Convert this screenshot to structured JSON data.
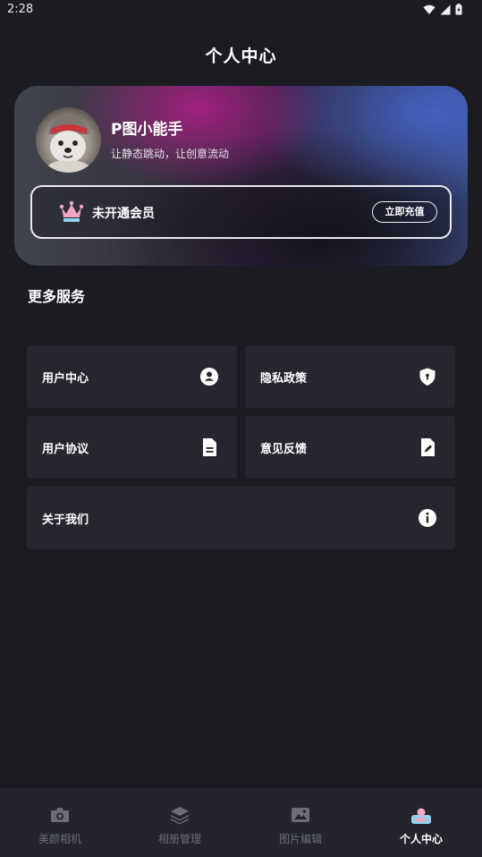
{
  "status_bar": {
    "time": "2:28"
  },
  "header": {
    "title": "个人中心"
  },
  "profile": {
    "name": "P图小能手",
    "slogan": "让静态跳动，让创意流动"
  },
  "vip": {
    "status": "未开通会员",
    "button_label": "立即充值"
  },
  "services": {
    "title": "更多服务",
    "items": [
      {
        "label": "用户中心",
        "icon": "user-circle-icon"
      },
      {
        "label": "隐私政策",
        "icon": "shield-icon"
      },
      {
        "label": "用户协议",
        "icon": "document-icon"
      },
      {
        "label": "意见反馈",
        "icon": "edit-icon"
      },
      {
        "label": "关于我们",
        "icon": "info-icon"
      }
    ]
  },
  "bottom_nav": {
    "items": [
      {
        "label": "美颜相机",
        "icon": "camera-icon",
        "active": false
      },
      {
        "label": "相册管理",
        "icon": "layers-icon",
        "active": false
      },
      {
        "label": "图片编辑",
        "icon": "image-icon",
        "active": false
      },
      {
        "label": "个人中心",
        "icon": "profile-icon",
        "active": true
      }
    ]
  },
  "colors": {
    "background": "#1b1c21",
    "card": "#26272e",
    "nav_background": "#24252c",
    "nav_inactive": "#6c6d75",
    "crown_pink": "#f2a6c4",
    "crown_blue": "#8fd2f0"
  }
}
